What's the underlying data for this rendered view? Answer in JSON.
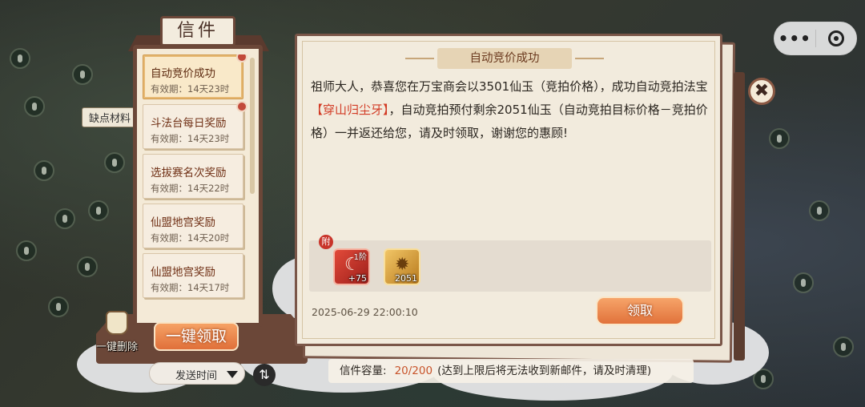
{
  "left_panel": {
    "title": "信件",
    "mails": [
      {
        "subject": "自动竞价成功",
        "expiry": "有效期：14天23时",
        "selected": true,
        "unread": true
      },
      {
        "subject": "斗法台每日奖励",
        "expiry": "有效期：14天23时",
        "selected": false,
        "unread": true
      },
      {
        "subject": "选拔赛名次奖励",
        "expiry": "有效期：14天22时",
        "selected": false,
        "unread": false
      },
      {
        "subject": "仙盟地宫奖励",
        "expiry": "有效期：14天20时",
        "selected": false,
        "unread": false
      },
      {
        "subject": "仙盟地宫奖励",
        "expiry": "有效期：14天17时",
        "selected": false,
        "unread": false
      }
    ],
    "delete_all_label": "一键删除",
    "claim_all_label": "一键领取",
    "sort_label": "发送时间",
    "sort_toggle_icon": "⇅"
  },
  "background": {
    "map_label": "缺点材料"
  },
  "letter": {
    "heading": "自动竞价成功",
    "text_part1": "祖师大人，恭喜您在万宝商会以3501仙玉（竞拍价格），成功自动竞拍法宝",
    "item_name": "【穿山归尘牙】",
    "text_part2": "，自动竞拍预付剩余2051仙玉（自动竞拍目标价格－竞拍价格）一并返还给您，请及时领取，谢谢您的惠顾!",
    "attachment_tag": "附",
    "attachments": [
      {
        "name": "fang-item",
        "icon": "fang-icon",
        "tier": "1阶",
        "quantity": "+75"
      },
      {
        "name": "jade-item",
        "icon": "dragon-coin-icon",
        "tier": "",
        "quantity": "2051"
      }
    ],
    "date": "2025-06-29 22:00:10",
    "claim_label": "领取",
    "close_icon": "✖"
  },
  "footer": {
    "capacity_label": "信件容量:",
    "capacity_value": "20/200",
    "capacity_note": "(达到上限后将无法收到新邮件，请及时清理)"
  },
  "wechat_capsule": {
    "more_icon": "•••",
    "close_icon": "target-icon"
  },
  "colors": {
    "frame": "#6b4738",
    "accent_orange": "#e0703a",
    "highlight_red": "#d23a24"
  }
}
